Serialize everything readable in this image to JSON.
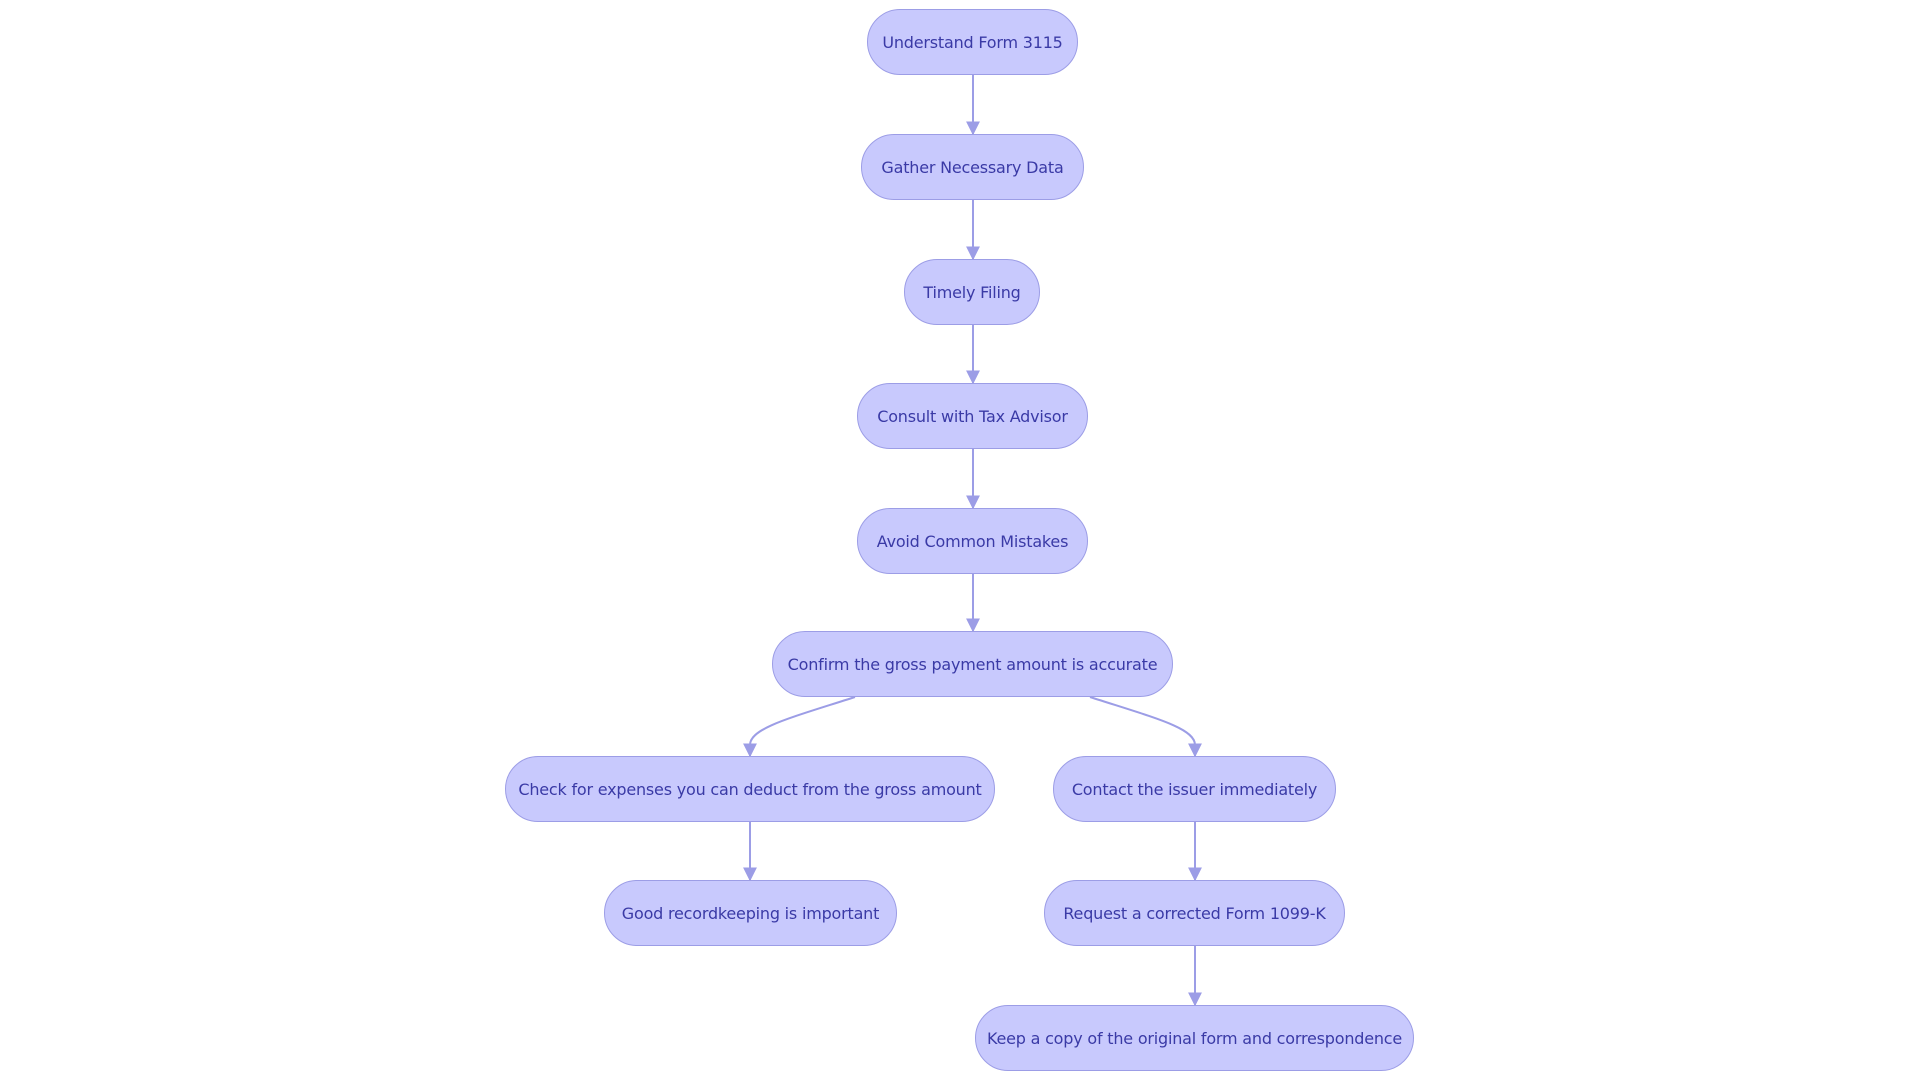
{
  "diagram": {
    "type": "flowchart",
    "colors": {
      "node_fill": "#c8c9fd",
      "node_stroke": "#9c9de6",
      "edge": "#9c9de6",
      "text": "#3a3aa6"
    },
    "nodes": [
      {
        "id": "n1",
        "label": "Understand Form 3115"
      },
      {
        "id": "n2",
        "label": "Gather Necessary Data"
      },
      {
        "id": "n3",
        "label": "Timely Filing"
      },
      {
        "id": "n4",
        "label": "Consult with Tax Advisor"
      },
      {
        "id": "n5",
        "label": "Avoid Common Mistakes"
      },
      {
        "id": "n6",
        "label": "Confirm the gross payment amount is accurate"
      },
      {
        "id": "n7",
        "label": "Check for expenses you can deduct from the gross amount"
      },
      {
        "id": "n8",
        "label": "Good recordkeeping is important"
      },
      {
        "id": "n9",
        "label": "Contact the issuer immediately"
      },
      {
        "id": "n10",
        "label": "Request a corrected Form 1099-K"
      },
      {
        "id": "n11",
        "label": "Keep a copy of the original form and correspondence"
      }
    ],
    "edges": [
      {
        "from": "n1",
        "to": "n2"
      },
      {
        "from": "n2",
        "to": "n3"
      },
      {
        "from": "n3",
        "to": "n4"
      },
      {
        "from": "n4",
        "to": "n5"
      },
      {
        "from": "n5",
        "to": "n6"
      },
      {
        "from": "n6",
        "to": "n7"
      },
      {
        "from": "n7",
        "to": "n8"
      },
      {
        "from": "n6",
        "to": "n9"
      },
      {
        "from": "n9",
        "to": "n10"
      },
      {
        "from": "n10",
        "to": "n11"
      }
    ]
  }
}
